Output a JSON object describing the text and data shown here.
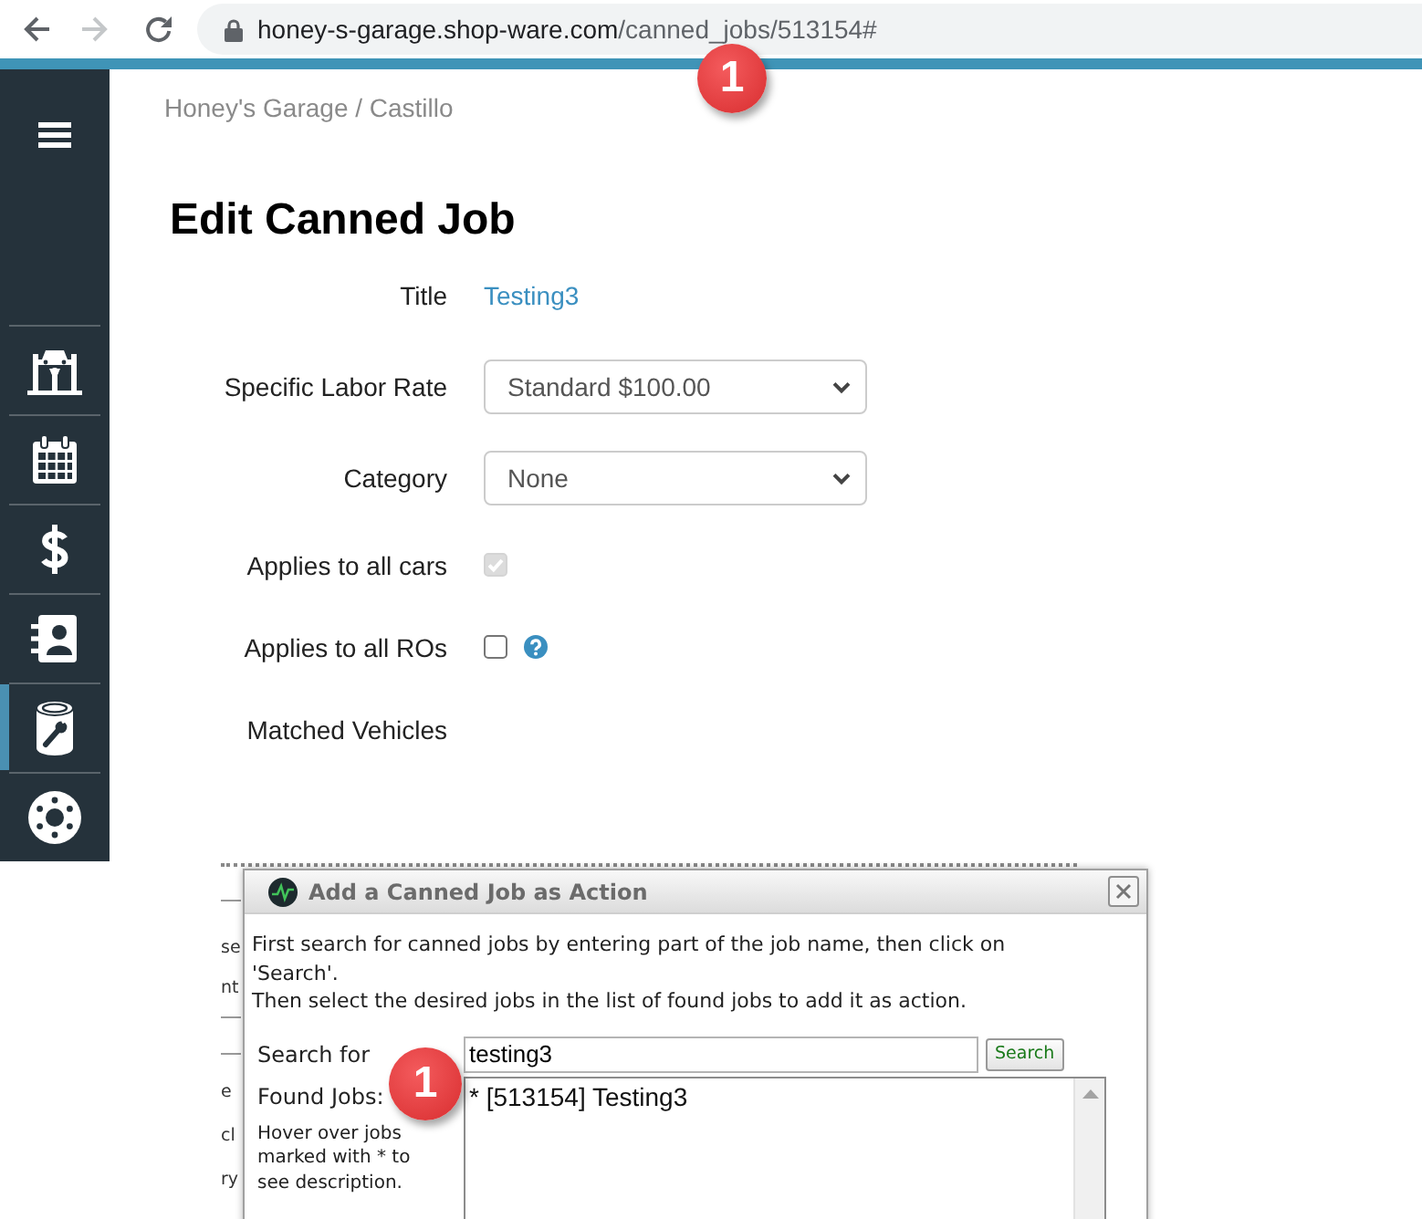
{
  "browser": {
    "back_disabled": false,
    "forward_disabled": true,
    "url_host": "honey-s-garage.shop-ware.com",
    "url_path": "/canned_jobs/513154#",
    "annotation": "1"
  },
  "sidebar": {
    "items": [
      {
        "selected": false
      },
      {
        "selected": false
      },
      {
        "selected": false
      },
      {
        "selected": false
      },
      {
        "selected": true
      },
      {
        "selected": false
      }
    ]
  },
  "breadcrumb": "Honey's Garage / Castillo",
  "heading": "Edit Canned Job",
  "form": {
    "fields": [
      {
        "kind": "link",
        "label": "Title",
        "value": "Testing3"
      },
      {
        "kind": "select",
        "label": "Specific Labor Rate",
        "value": "Standard $100.00"
      },
      {
        "kind": "select",
        "label": "Category",
        "value": "None"
      },
      {
        "kind": "checkbox",
        "label": "Applies to all cars",
        "checked": true,
        "disabled": true,
        "help": false
      },
      {
        "kind": "checkbox",
        "label": "Applies to all ROs",
        "checked": false,
        "disabled": false,
        "help": true
      },
      {
        "kind": "label",
        "label": "Matched Vehicles"
      }
    ]
  },
  "background_fragments": [
    "se",
    "nt",
    "e",
    "cl",
    "ry"
  ],
  "dialog": {
    "title": "Add a Canned Job as Action",
    "intro": [
      "First search for canned jobs by entering part of the job name, then click on 'Search'.",
      "Then select the desired jobs in the list of found jobs to add it as action."
    ],
    "search_label": "Search for",
    "search_value": "testing3",
    "search_button": "Search",
    "found_label": "Found Jobs:",
    "hint": "Hover over jobs marked with * to see description.",
    "found_jobs": [
      {
        "label": "* [513154] Testing3",
        "selected": false
      }
    ],
    "annotation": "1"
  }
}
